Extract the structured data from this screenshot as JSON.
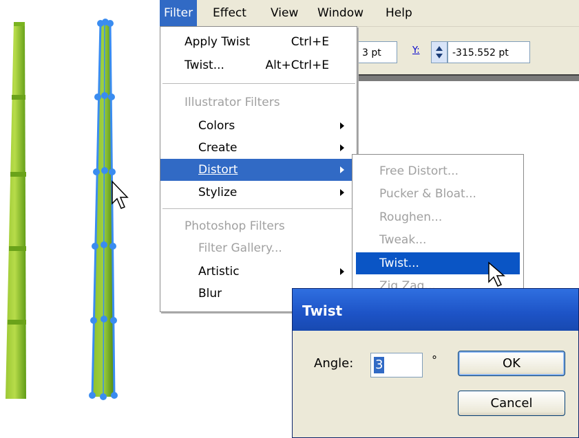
{
  "menubar": {
    "items": [
      {
        "label": "Filter",
        "active": true
      },
      {
        "label": "Effect",
        "active": false
      },
      {
        "label": "View",
        "active": false
      },
      {
        "label": "Window",
        "active": false
      },
      {
        "label": "Help",
        "active": false
      }
    ]
  },
  "control_panel": {
    "x_value_partial": "3 pt",
    "y_label": "Y:",
    "y_value": "-315.552 pt"
  },
  "filter_menu": {
    "apply_twist": {
      "label": "Apply Twist",
      "shortcut": "Ctrl+E"
    },
    "twist": {
      "label": "Twist...",
      "shortcut": "Alt+Ctrl+E"
    },
    "illustrator_header": "Illustrator Filters",
    "colors": "Colors",
    "create": "Create",
    "distort": "Distort",
    "stylize": "Stylize",
    "photoshop_header": "Photoshop Filters",
    "filter_gallery": "Filter Gallery...",
    "artistic": "Artistic",
    "blur": "Blur"
  },
  "distort_submenu": {
    "items": [
      "Free Distort...",
      "Pucker & Bloat...",
      "Roughen...",
      "Tweak...",
      "Twist...",
      "Zig Zag..."
    ],
    "selected": "Twist..."
  },
  "twist_dialog": {
    "title": "Twist",
    "angle_label": "Angle:",
    "angle_value": "3",
    "degree_symbol": "°",
    "ok_label": "OK",
    "cancel_label": "Cancel"
  },
  "colors": {
    "menu_highlight": "#316ac5",
    "dialog_title": "#1d53c6",
    "bamboo_light": "#a8d23a",
    "bamboo_dark": "#5a9a12",
    "anchor_blue": "#3a8cf0"
  }
}
